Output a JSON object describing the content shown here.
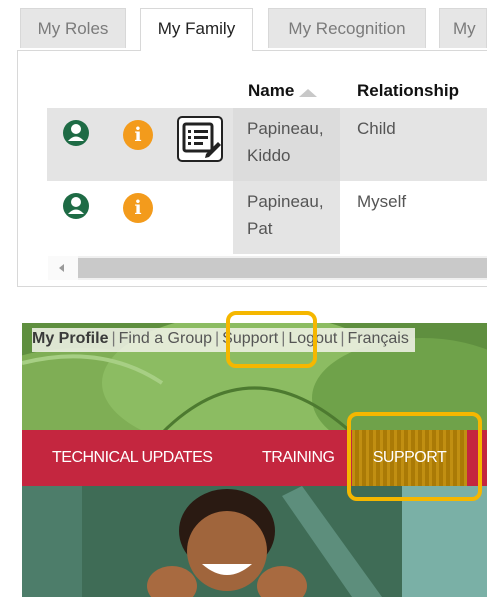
{
  "tabs": [
    {
      "label": "My Roles",
      "active": false
    },
    {
      "label": "My Family",
      "active": true
    },
    {
      "label": "My Recognition",
      "active": false
    },
    {
      "label": "My",
      "active": false
    }
  ],
  "table": {
    "columns": [
      "Name",
      "Relationship"
    ],
    "sort_column": "Name",
    "rows": [
      {
        "name": "Papineau, Kiddo",
        "relationship": "Child",
        "icons": [
          "person-icon",
          "info-icon",
          "edit-icon"
        ]
      },
      {
        "name": "Papineau, Pat",
        "relationship": "Myself",
        "icons": [
          "person-icon",
          "info-icon"
        ]
      }
    ]
  },
  "site": {
    "top_links": {
      "profile": "My Profile",
      "find_group": "Find a Group",
      "support": "Support",
      "logout": "Logout",
      "language": "Français",
      "separator": "|"
    },
    "nav": {
      "technical_updates": "TECHNICAL UPDATES",
      "training": "TRAINING",
      "support": "SUPPORT"
    }
  },
  "colors": {
    "nav_bar": "#c4263f",
    "highlight": "#f5b700",
    "info_icon": "#f39b1c",
    "person_icon": "#1e6b45"
  }
}
